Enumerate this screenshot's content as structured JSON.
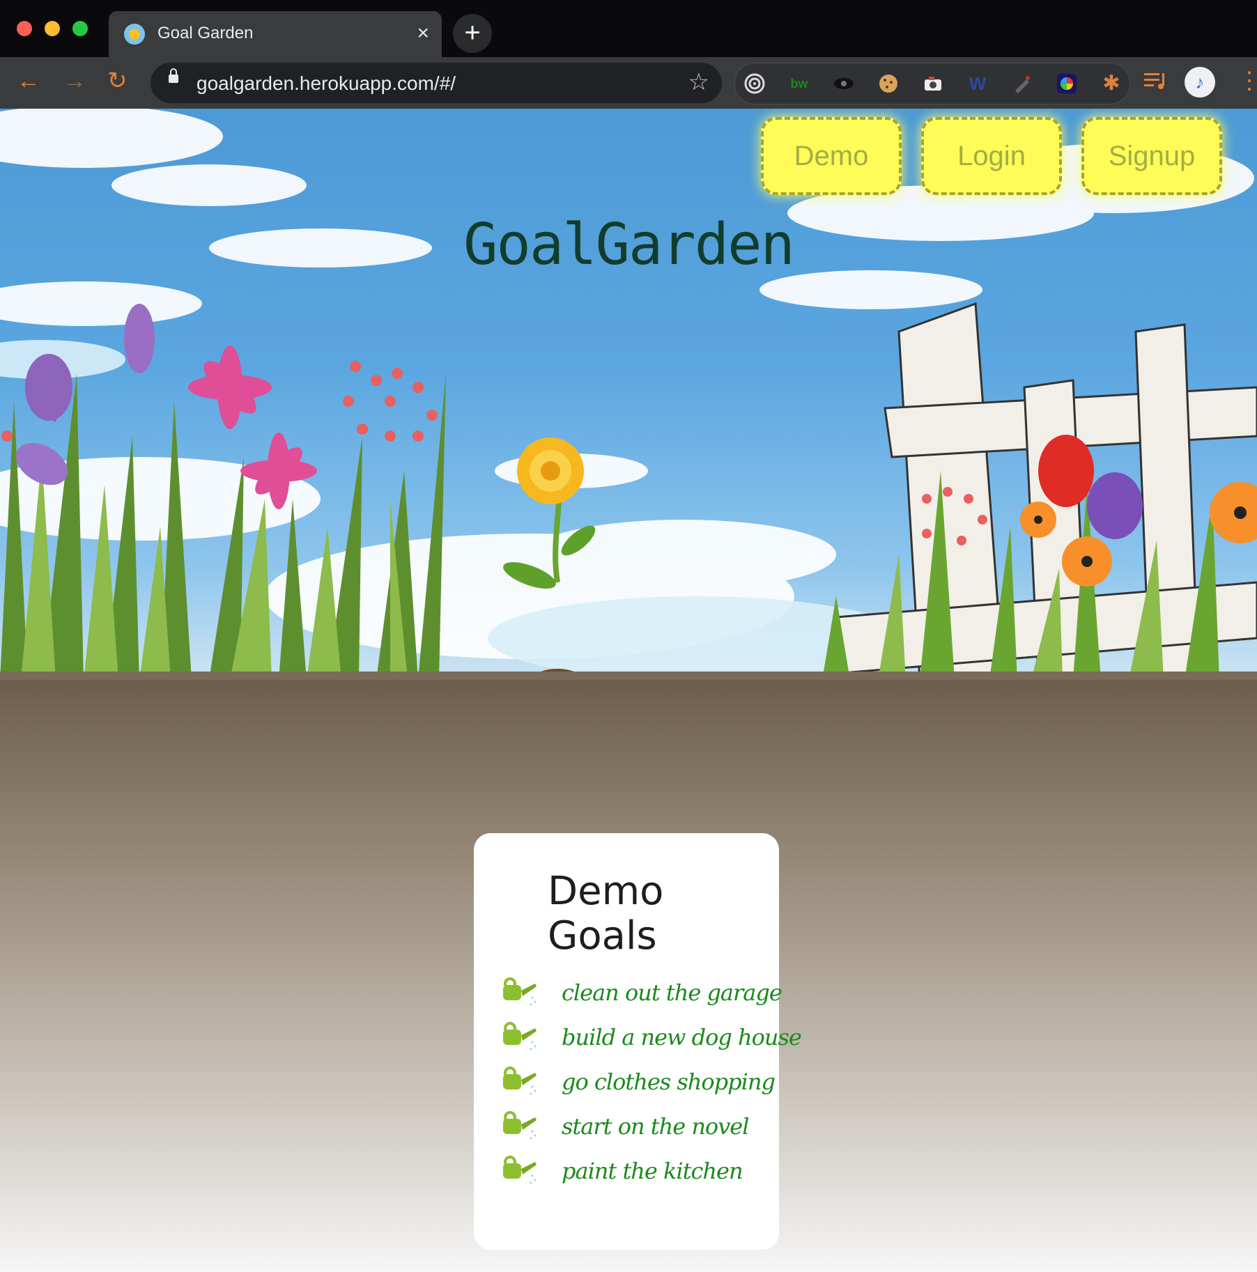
{
  "browser": {
    "tab_title": "Goal Garden",
    "tab_close": "×",
    "new_tab": "+",
    "url": "goalgarden.herokuapp.com/#/",
    "back": "←",
    "forward": "→",
    "reload": "↻",
    "star": "☆",
    "menu": "⋮",
    "profile": "♪"
  },
  "nav": {
    "demo_label": "Demo",
    "login_label": "Login",
    "signup_label": "Signup"
  },
  "hero": {
    "title": "GoalGarden"
  },
  "demo_card": {
    "title": "Demo Goals",
    "goals": [
      "clean out the garage",
      "build a new dog house",
      "go clothes shopping",
      "start on the novel",
      "paint the kitchen"
    ]
  },
  "colors": {
    "button_fill": "#fffc58",
    "button_text": "#a3ad45",
    "title_color": "#123d2c",
    "goal_text": "#1a8a1a",
    "soil": "#6d5e4c",
    "sky": "#5ba6e0"
  }
}
